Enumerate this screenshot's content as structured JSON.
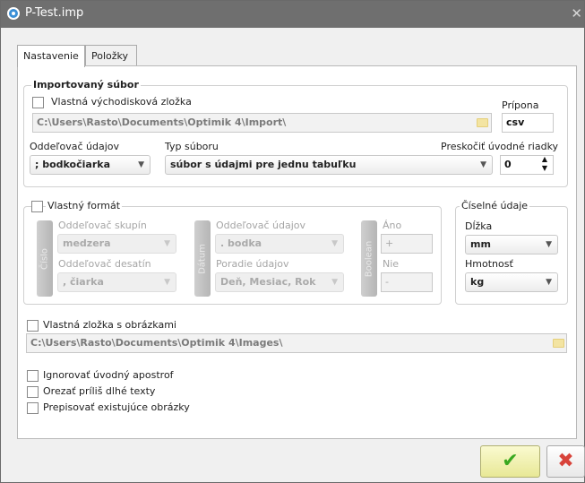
{
  "window": {
    "title": "P-Test.imp",
    "close_glyph": "✕"
  },
  "tabs": [
    {
      "label": "Nastavenie"
    },
    {
      "label": "Položky"
    }
  ],
  "imported_file": {
    "group_title": "Importovaný súbor",
    "custom_folder_label": "Vlastná východisková zložka",
    "path_value": "C:\\Users\\Rasto\\Documents\\Optimik 4\\Import\\",
    "extension_label": "Prípona",
    "extension_value": "csv",
    "separator_label": "Oddeľovač údajov",
    "separator_value": "; bodkočiarka",
    "file_type_label": "Typ súboru",
    "file_type_value": "súbor s údajmi pre jednu tabuľku",
    "skip_rows_label": "Preskočiť úvodné riadky",
    "skip_rows_value": "0"
  },
  "custom_format": {
    "group_title": "Vlastný formát",
    "number_bar": "Číslo",
    "date_bar": "Dátum",
    "boolean_bar": "Boolean",
    "group_sep_label": "Oddeľovač skupín",
    "group_sep_value": "medzera",
    "decimal_sep_label": "Oddeľovač desatín",
    "decimal_sep_value": ", čiarka",
    "date_sep_label": "Oddeľovač údajov",
    "date_sep_value": ". bodka",
    "date_order_label": "Poradie údajov",
    "date_order_value": "Deň, Mesiac, Rok",
    "yes_label": "Áno",
    "yes_value": "+",
    "no_label": "Nie",
    "no_value": "-"
  },
  "numeric": {
    "group_title": "Číselné údaje",
    "length_label": "Dĺžka",
    "length_value": "mm",
    "weight_label": "Hmotnosť",
    "weight_value": "kg"
  },
  "images": {
    "custom_folder_label": "Vlastná zložka s obrázkami",
    "path_value": "C:\\Users\\Rasto\\Documents\\Optimik 4\\Images\\"
  },
  "options": [
    {
      "label": "Ignorovať úvodný apostrof"
    },
    {
      "label": "Orezať príliš dlhé texty"
    },
    {
      "label": "Prepisovať existujúce obrázky"
    }
  ],
  "buttons": {
    "ok_glyph": "✔",
    "cancel_glyph": "✖"
  },
  "icons": {
    "app": "app-icon",
    "folder": "folder-icon",
    "ok": "checkmark-icon",
    "cancel": "cross-icon"
  }
}
